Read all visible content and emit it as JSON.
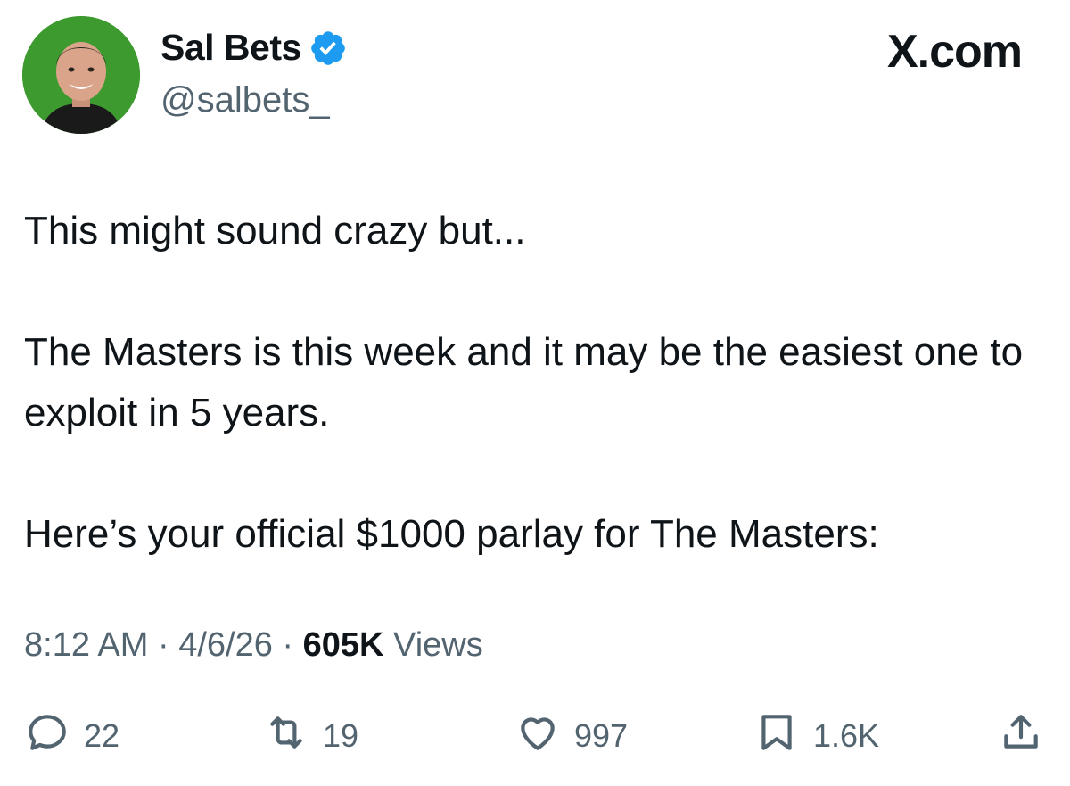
{
  "author": {
    "display_name": "Sal Bets",
    "handle": "@salbets_",
    "verified": true,
    "avatar_bg": "#3d9a2e"
  },
  "brand": "X.com",
  "tweet": {
    "lines": [
      "This might sound crazy but...",
      "The Masters is this week and it may be the easiest one to exploit in 5 years.",
      "Here’s your official $1000 parlay for The Masters:"
    ]
  },
  "meta": {
    "time": "8:12 AM",
    "sep1": "·",
    "date": "4/6/26",
    "sep2": "·",
    "views_count": "605K",
    "views_label": "Views"
  },
  "actions": {
    "replies": "22",
    "reposts": "19",
    "likes": "997",
    "bookmarks": "1.6K"
  },
  "colors": {
    "text": "#0f1419",
    "secondary": "#536471",
    "verified": "#1d9bf0"
  },
  "icons": [
    "verified-badge-icon",
    "reply-icon",
    "repost-icon",
    "like-icon",
    "bookmark-icon",
    "share-icon"
  ]
}
